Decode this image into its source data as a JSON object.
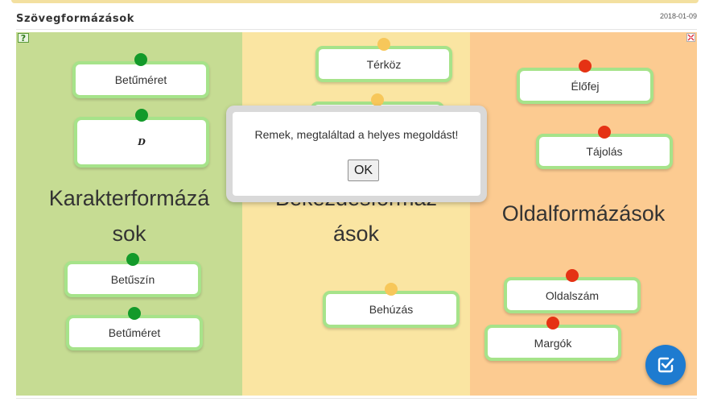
{
  "header": {
    "title": "Szövegformázások",
    "date": "2018-01-09"
  },
  "columns": [
    {
      "label_line1": "Karakterformázá",
      "label_line2": "sok",
      "color": "#c6dc93"
    },
    {
      "label_line1": "Bekezdésformáz",
      "label_line2": "ások",
      "color": "#fae5a2"
    },
    {
      "label_line1": "Oldalformázások",
      "label_line2": "",
      "color": "#fccb91"
    }
  ],
  "cards": {
    "betumeret_top": "Betűméret",
    "image_card_glyph": "D",
    "betuszin": "Betűszín",
    "betumeret_bottom": "Betűméret",
    "terkoz": "Térköz",
    "hidden_card": "",
    "behuzas": "Behúzás",
    "elofej": "Élőfej",
    "tajolas": "Tájolás",
    "oldalszam": "Oldalszám",
    "margok": "Margók"
  },
  "dialog": {
    "message": "Remek, megtaláltad a helyes megoldást!",
    "ok_label": "OK"
  },
  "icons": [
    "help-icon",
    "expand-icon",
    "check-icon"
  ],
  "colors": {
    "card_border": "#a6e38a",
    "dot_green": "#139a2a",
    "dot_yellow": "#f7c75a",
    "dot_red": "#e53214",
    "check_button": "#1e7bd0"
  }
}
